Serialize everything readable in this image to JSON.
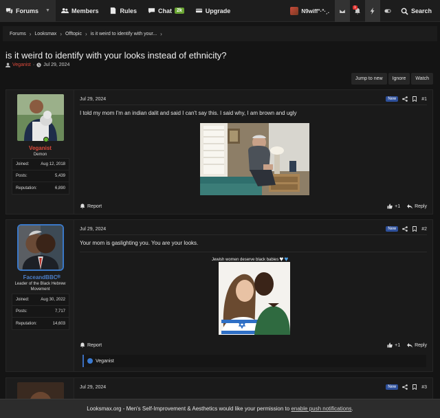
{
  "nav": {
    "forums": "Forums",
    "members": "Members",
    "rules": "Rules",
    "chat": "Chat",
    "chat_badge": "2k",
    "upgrade": "Upgrade",
    "username": "N9wiff°·°·¸.",
    "alert_count": "1",
    "search": "Search"
  },
  "breadcrumb": [
    "Forums",
    "Looksmax",
    "Offtopic",
    "is it weird to identify with your..."
  ],
  "thread": {
    "title": "is it weird to identify with your looks instead of ethnicity?",
    "author": "Veganist",
    "sep": "·",
    "date": "Jul 29, 2024"
  },
  "thread_actions": [
    "Jump to new",
    "Ignore",
    "Watch"
  ],
  "posts": [
    {
      "date": "Jul 29, 2024",
      "badge": "New",
      "number": "#1",
      "username": "Veganist",
      "name_color": "#e04a3c",
      "user_title": "Demon",
      "stats": [
        {
          "label": "Joined:",
          "value": "Aug 12, 2018"
        },
        {
          "label": "Posts:",
          "value": "5,439"
        },
        {
          "label": "Reputation:",
          "value": "6,890"
        }
      ],
      "body": "I told my mom I'm an indian dalit and said I can't say this. I said why, I am brown and ugly",
      "report": "Report",
      "reactions": "+1",
      "reply": "Reply"
    },
    {
      "date": "Jul 29, 2024",
      "badge": "New",
      "number": "#2",
      "username": "FaceandBBC",
      "name_color": "#4c7fc9",
      "user_title": "Leader of the Black Hebrew Movement",
      "stats": [
        {
          "label": "Joined:",
          "value": "Aug 30, 2022"
        },
        {
          "label": "Posts:",
          "value": "7,717"
        },
        {
          "label": "Reputation:",
          "value": "14,603"
        }
      ],
      "body": "Your mom is gaslighting you. You are your looks.",
      "signature": "Jewish women deserve black babies",
      "report": "Report",
      "reactions": "+1",
      "reply": "Reply",
      "reacted_by": "Veganist"
    },
    {
      "date": "Jul 29, 2024",
      "badge": "New",
      "number": "#3"
    }
  ],
  "notice": {
    "text": "Looksmax.org - Men's Self-Improvement & Aesthetics would like your permission to",
    "link": "enable push notifications",
    "end": "."
  },
  "colors": {
    "background": "#141414",
    "accent_blue": "#2d4f9a",
    "online": "#63b22e",
    "chat_badge": "#6aa533"
  }
}
